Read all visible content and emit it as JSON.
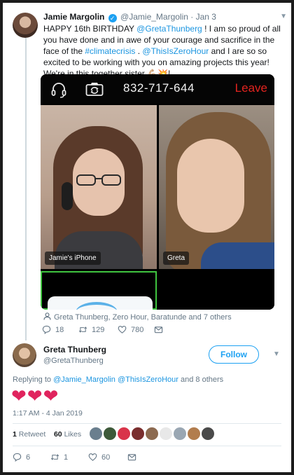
{
  "tweet": {
    "author_name": "Jamie Margolin",
    "verified_mark": "✓",
    "handle": "@Jamie_Margolin",
    "separator": "·",
    "date": "Jan 3",
    "text_part1": "HAPPY 16th BIRTHDAY ",
    "mention_greta": "@GretaThunberg",
    "text_part2": " ! I am so proud of all you have done and in awe of your courage and sacrifice in the face of the ",
    "hashtag": "#climatecrisis",
    "text_part3": " . ",
    "mention_zero": "@ThisIsZeroHour",
    "text_part4": " and I are so so excited to be working with you on amazing projects this year! We're in this together sister ",
    "emoji": "💪🏼💥!",
    "media": {
      "phone_number": "832-717-644",
      "leave_label": "Leave",
      "left_label": "Jamie's iPhone",
      "right_label": "Greta"
    },
    "tagged_people": "Greta Thunberg, Zero Hour, Baratunde and 7 others",
    "replies": "18",
    "retweets": "129",
    "likes": "780"
  },
  "reply": {
    "author_name": "Greta Thunberg",
    "handle": "@GretaThunberg",
    "follow_label": "Follow",
    "replying_prefix": "Replying to ",
    "replying_mentions": "@Jamie_Margolin @ThisIsZeroHour",
    "replying_suffix": " and 8 others",
    "body": "❤❤❤",
    "timestamp": "1:17 AM - 4 Jan 2019",
    "retweet_count": "1",
    "retweet_label": "Retweet",
    "like_count": "60",
    "like_label": "Likes",
    "replies": "6",
    "retweets": "1",
    "likes": "60"
  },
  "colors": {
    "accent": "#1da1f2",
    "link": "#1b95e0",
    "heart": "#e0245e",
    "leave_red": "#e3241f",
    "muted": "#657786"
  }
}
